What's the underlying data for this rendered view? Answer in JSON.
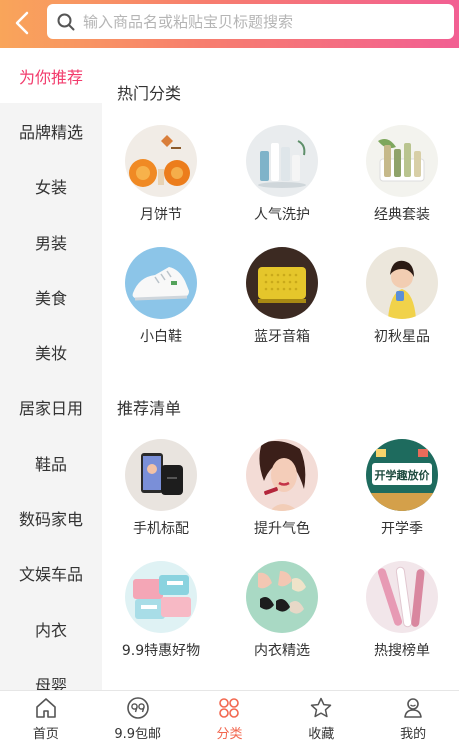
{
  "search": {
    "placeholder": "输入商品名或粘贴宝贝标题搜索"
  },
  "sidebar": {
    "items": [
      {
        "label": "为你推荐",
        "active": true
      },
      {
        "label": "品牌精选"
      },
      {
        "label": "女装"
      },
      {
        "label": "男装"
      },
      {
        "label": "美食"
      },
      {
        "label": "美妆"
      },
      {
        "label": "居家日用"
      },
      {
        "label": "鞋品"
      },
      {
        "label": "数码家电"
      },
      {
        "label": "文娱车品"
      },
      {
        "label": "内衣"
      },
      {
        "label": "母婴"
      }
    ]
  },
  "sections": [
    {
      "title": "热门分类",
      "items": [
        {
          "label": "月饼节",
          "icon": "mooncake-flower-image"
        },
        {
          "label": "人气洗护",
          "icon": "skincare-bottles-image"
        },
        {
          "label": "经典套装",
          "icon": "cosmetic-set-image"
        },
        {
          "label": "小白鞋",
          "icon": "white-sneaker-image"
        },
        {
          "label": "蓝牙音箱",
          "icon": "bluetooth-speaker-image"
        },
        {
          "label": "初秋星品",
          "icon": "autumn-model-image"
        }
      ]
    },
    {
      "title": "推荐清单",
      "items": [
        {
          "label": "手机标配",
          "icon": "phone-powerbank-image"
        },
        {
          "label": "提升气色",
          "icon": "lipstick-model-image"
        },
        {
          "label": "开学季",
          "icon": "back-to-school-image",
          "badge": "开学趣放价"
        },
        {
          "label": "9.9特惠好物",
          "icon": "tissue-pack-image"
        },
        {
          "label": "内衣精选",
          "icon": "lingerie-image"
        },
        {
          "label": "热搜榜单",
          "icon": "electric-toothbrush-image"
        }
      ]
    }
  ],
  "tabbar": {
    "tabs": [
      {
        "label": "首页",
        "icon": "home-icon"
      },
      {
        "label": "9.9包邮",
        "icon": "99-badge-icon"
      },
      {
        "label": "分类",
        "icon": "category-grid-icon",
        "active": true
      },
      {
        "label": "收藏",
        "icon": "star-icon"
      },
      {
        "label": "我的",
        "icon": "user-icon"
      }
    ]
  },
  "colors": {
    "accent": "#f23b6c",
    "header_gradient": [
      "#f9a55a",
      "#f25f93"
    ],
    "active_tab": "#f2674f"
  }
}
